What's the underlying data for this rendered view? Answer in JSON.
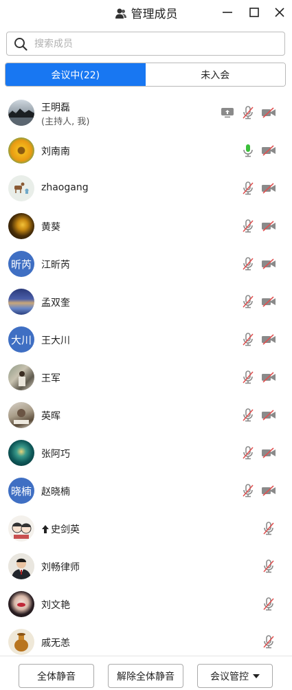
{
  "window": {
    "title": "管理成员",
    "title_icon": "people-icon",
    "controls": [
      "minimize-icon",
      "maximize-icon",
      "close-icon"
    ]
  },
  "search": {
    "placeholder": "搜索成员",
    "value": ""
  },
  "tabs": [
    {
      "label": "会议中(22)",
      "active": true
    },
    {
      "label": "未入会",
      "active": false
    }
  ],
  "colors": {
    "accent": "#1877f2",
    "mic_on": "#3bbf3b",
    "muted_slash": "#e05050",
    "icon_gray": "#8a8a8a",
    "initials_avatar": "#3f6fc3"
  },
  "members": [
    {
      "name": "王明磊",
      "note": "(主持人, 我)",
      "avatar": "photo-landscape",
      "sharing": true,
      "mic": "muted",
      "camera": "off"
    },
    {
      "name": "刘南南",
      "avatar": "photo-sunflower",
      "mic": "on",
      "camera": "off"
    },
    {
      "name": "zhaogang",
      "avatar": "photo-deer",
      "mic": "muted",
      "camera": "off"
    },
    {
      "name": "黄葵",
      "avatar": "photo-tree",
      "mic": "muted",
      "camera": "off"
    },
    {
      "name": "江昕芮",
      "avatar_initials": "昕芮",
      "mic": "muted",
      "camera": "off"
    },
    {
      "name": "孟双奎",
      "avatar": "photo-city",
      "mic": "muted",
      "camera": "off"
    },
    {
      "name": "王大川",
      "avatar_initials": "大川",
      "mic": "muted",
      "camera": "off"
    },
    {
      "name": "王军",
      "avatar": "photo-street",
      "mic": "muted",
      "camera": "off"
    },
    {
      "name": "英晖",
      "avatar": "photo-room",
      "mic": "muted",
      "camera": "off"
    },
    {
      "name": "张阿巧",
      "avatar": "photo-teal",
      "mic": "muted",
      "camera": "off"
    },
    {
      "name": "赵晓楠",
      "avatar_initials": "晓楠",
      "mic": "muted",
      "camera": "off"
    },
    {
      "name": "史剑英",
      "avatar": "photo-cartoon",
      "hand_raised": true,
      "mic": "muted"
    },
    {
      "name": "刘畅律师",
      "avatar": "photo-portrait",
      "mic": "muted"
    },
    {
      "name": "刘文艳",
      "avatar": "photo-face",
      "mic": "muted"
    },
    {
      "name": "戚无恙",
      "avatar": "photo-pottery",
      "mic": "muted"
    }
  ],
  "footer": {
    "mute_all": "全体静音",
    "unmute_all": "解除全体静音",
    "meeting_control": "会议管控"
  }
}
